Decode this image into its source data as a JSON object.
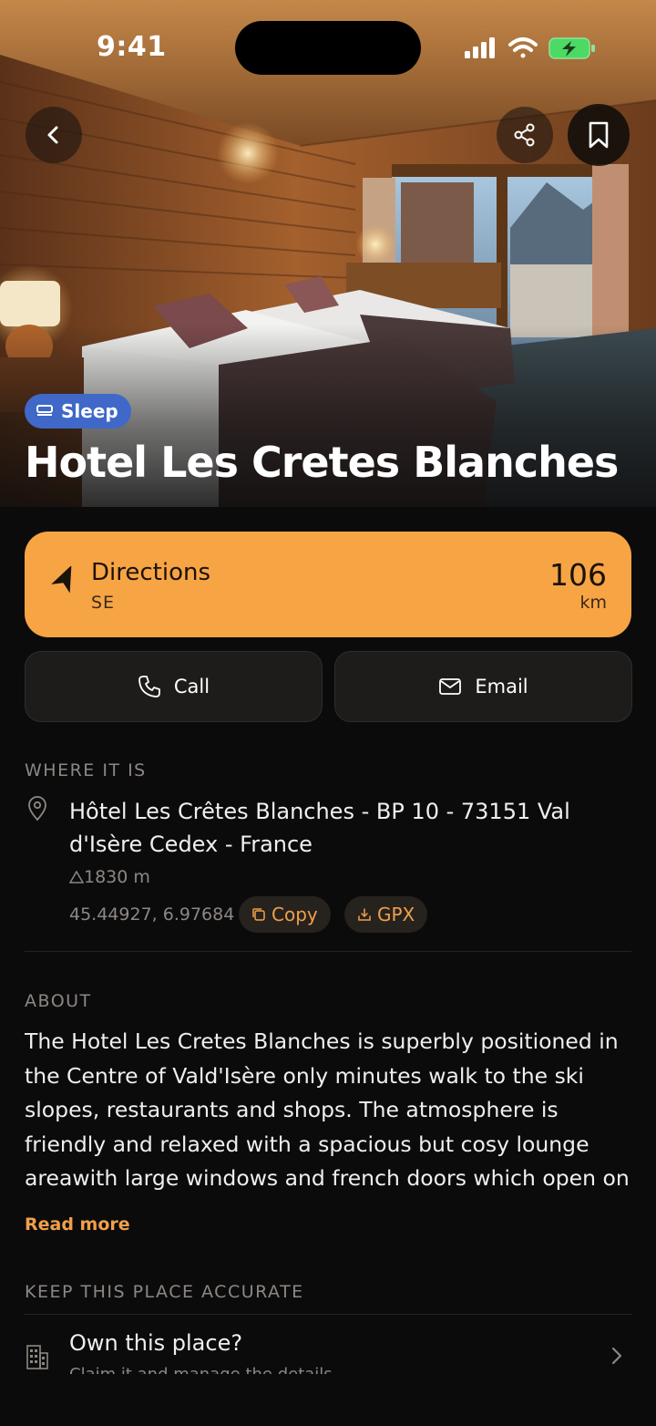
{
  "status_bar": {
    "time": "9:41"
  },
  "hero": {
    "category": "Sleep",
    "title": "Hotel Les Cretes Blanches"
  },
  "directions": {
    "label": "Directions",
    "bearing": "SE",
    "distance": "106",
    "unit": "km"
  },
  "actions": {
    "call": "Call",
    "email": "Email"
  },
  "where": {
    "heading": "WHERE IT IS",
    "address": "Hôtel Les Crêtes Blanches - BP 10 - 73151 Val d'Isère Cedex - France",
    "altitude": "1830 m",
    "coordinates": "45.44927, 6.97684",
    "copy_label": "Copy",
    "gpx_label": "GPX"
  },
  "about": {
    "heading": "ABOUT",
    "text": "The Hotel Les Cretes Blanches is superbly positioned in the Centre of Vald'Isère only minutes walk to the ski slopes, restaurants and shops. The atmosphere is friendly and relaxed with a spacious but cosy lounge areawith large windows and french doors which open on to a spe…",
    "read_more": "Read more"
  },
  "accuracy": {
    "heading": "KEEP THIS PLACE ACCURATE",
    "own_title": "Own this place?",
    "own_subtitle": "Claim it and manage the details"
  },
  "colors": {
    "accent": "#f7a445",
    "link": "#f0a04a",
    "chip": "#3f68c9",
    "background": "#0c0b0b"
  }
}
